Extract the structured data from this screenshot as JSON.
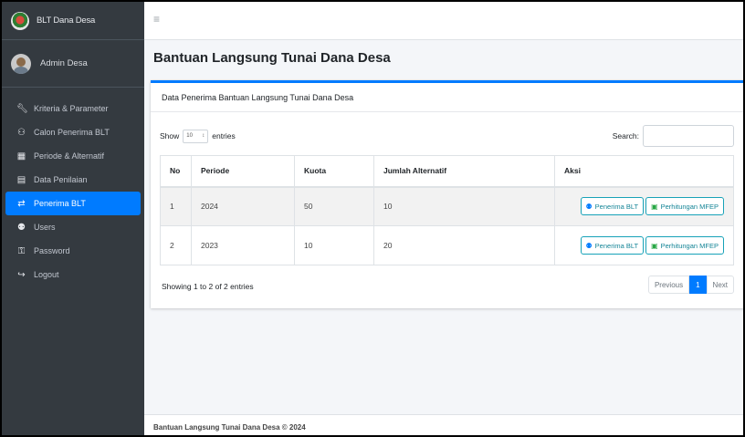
{
  "brand": {
    "title": "BLT Dana Desa"
  },
  "user": {
    "name": "Admin Desa"
  },
  "sidebar": {
    "items": [
      {
        "label": "Kriteria & Parameter",
        "icon": "wrench-icon"
      },
      {
        "label": "Calon Penerima BLT",
        "icon": "users-icon"
      },
      {
        "label": "Periode & Alternatif",
        "icon": "calendar-icon"
      },
      {
        "label": "Data Penilaian",
        "icon": "clipboard-icon"
      },
      {
        "label": "Penerima BLT",
        "icon": "user-arrows-icon",
        "active": true
      },
      {
        "label": "Users",
        "icon": "users-group-icon"
      },
      {
        "label": "Password",
        "icon": "key-icon"
      },
      {
        "label": "Logout",
        "icon": "sign-out-icon"
      }
    ]
  },
  "page": {
    "title": "Bantuan Langsung Tunai Dana Desa"
  },
  "card": {
    "header": "Data Penerima Bantuan Langsung Tunai Dana Desa"
  },
  "table_controls": {
    "show_label": "Show",
    "entries_value": "10",
    "entries_label": "entries",
    "search_label": "Search:"
  },
  "table": {
    "headers": [
      "No",
      "Periode",
      "Kuota",
      "Jumlah Alternatif",
      "Aksi"
    ],
    "rows": [
      {
        "no": "1",
        "periode": "2024",
        "kuota": "50",
        "jumlah": "10"
      },
      {
        "no": "2",
        "periode": "2023",
        "kuota": "10",
        "jumlah": "20"
      }
    ],
    "btn_penerima": "Penerima BLT",
    "btn_mfep": "Perhitungan MFEP"
  },
  "pagination": {
    "info": "Showing 1 to 2 of 2 entries",
    "previous": "Previous",
    "current": "1",
    "next": "Next"
  },
  "footer": {
    "text": "Bantuan Langsung Tunai Dana Desa © 2024"
  },
  "colors": {
    "primary": "#007bff",
    "sidebar": "#343a40",
    "info": "#17a2b8",
    "success": "#28a745"
  }
}
